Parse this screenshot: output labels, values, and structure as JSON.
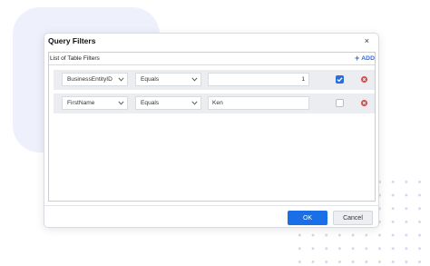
{
  "dialog": {
    "title": "Query Filters",
    "close_icon": "×",
    "panel_title": "List of Table Filters",
    "add_label": "ADD",
    "add_icon": "+"
  },
  "filters": [
    {
      "field": "BusinessEntityID",
      "operator": "Equals",
      "value": "1",
      "checked": true
    },
    {
      "field": "FirstName",
      "operator": "Equals",
      "value": "Ken",
      "checked": false
    }
  ],
  "footer": {
    "ok_label": "OK",
    "cancel_label": "Cancel"
  },
  "colors": {
    "accent": "#1a6ee6",
    "remove": "#e04848",
    "row_bg": "#ebedf1"
  }
}
